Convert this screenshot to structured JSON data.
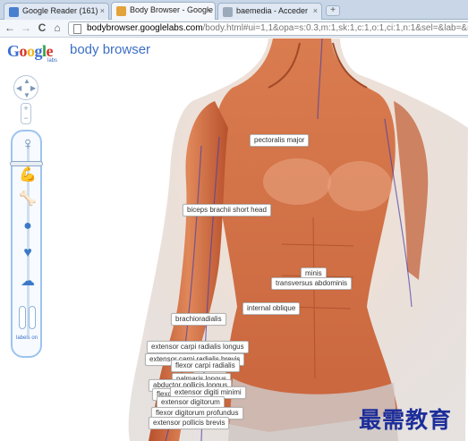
{
  "browser": {
    "tabs": [
      {
        "title": "Google Reader (161)",
        "favicon_color": "#4a7fd0"
      },
      {
        "title": "Body Browser - Google L...",
        "favicon_color": "#e2a33a"
      },
      {
        "title": "baemedia - Acceder",
        "favicon_color": "#9aaabb"
      }
    ],
    "close_glyph": "×",
    "new_tab_glyph": "+",
    "nav": {
      "back": "←",
      "forward": "→",
      "reload": "C",
      "home": "⌂"
    },
    "url_host": "bodybrowser.googlelabs.com",
    "url_path": "/body.html#ui=1,1&opa=s:0.3,m:1,sk:1,c:1,o:1,ci:1,n:1&sel=&lab=&nav=8.42,108"
  },
  "app": {
    "logo_letters": [
      "G",
      "o",
      "o",
      "g",
      "l",
      "e"
    ],
    "logo_colors": [
      "#3b6fd0",
      "#d8352a",
      "#f1b51c",
      "#3b6fd0",
      "#2f9e44",
      "#d8352a"
    ],
    "labs": "labs",
    "product": "body browser",
    "labels_toggle": "labels\non"
  },
  "labels": [
    "pectoralis major",
    "biceps brachii short head",
    "minis",
    "transversus abdominis",
    "internal oblique",
    "brachioradialis",
    "extensor carpi radialis longus",
    "extensor carpi radialis brevis",
    "flexor carpi radialis",
    "palmaris longus",
    "abductor pollicis longus",
    "flexor",
    "extensor digiti minimi",
    "extensor digitorum",
    "flexor digitorum profundus",
    "extensor pollicis brevis"
  ],
  "watermark": "最需教育",
  "colors": {
    "accent": "#3d6fc5",
    "skin_light": "#f0c39a",
    "muscle": "#c9653d"
  }
}
